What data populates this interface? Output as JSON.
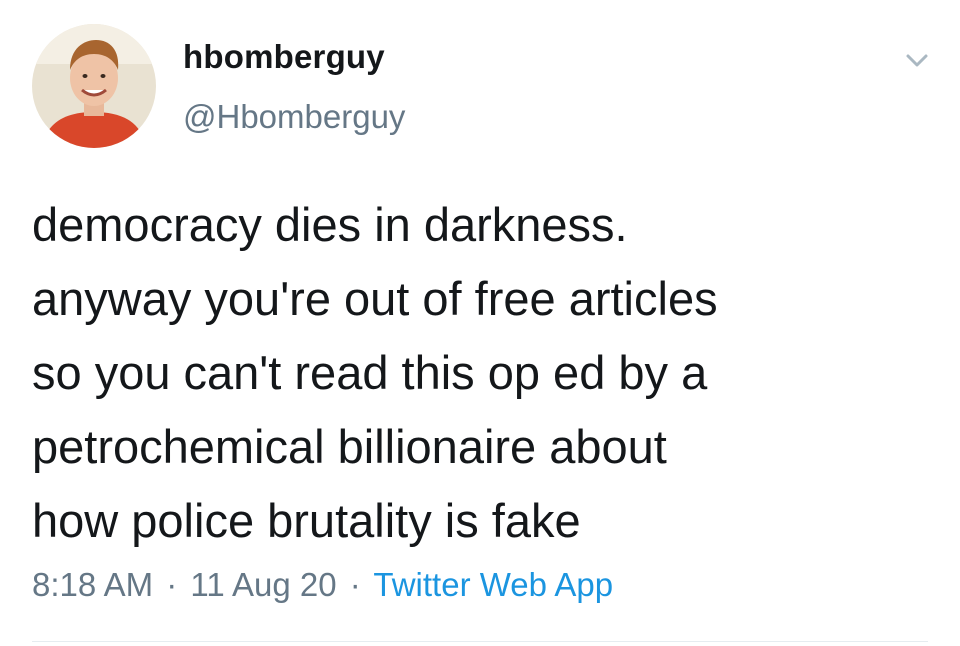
{
  "user": {
    "display_name": "hbomberguy",
    "handle": "@Hbomberguy",
    "avatar_icon": "profile-photo"
  },
  "tweet": {
    "lines": [
      "democracy dies in darkness.",
      "anyway you're out of free articles",
      "so you can't read this op ed by a",
      "petrochemical billionaire about",
      "how police brutality is fake"
    ]
  },
  "meta": {
    "time": "8:18 AM",
    "separator": "·",
    "date": "11 Aug 20",
    "source": "Twitter Web App"
  },
  "colors": {
    "text": "#14171a",
    "secondary": "#657786",
    "link": "#1b95e0",
    "divider": "#e6ecf0"
  },
  "icons": {
    "menu": "chevron-down-icon"
  }
}
